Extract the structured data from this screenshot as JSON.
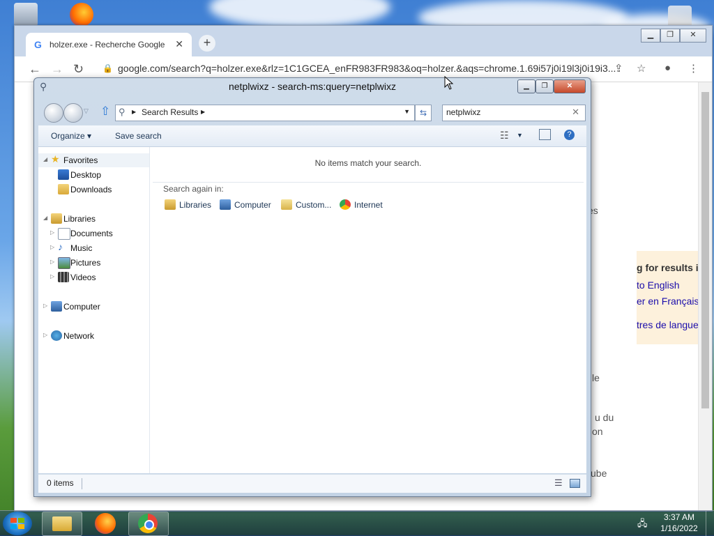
{
  "chrome": {
    "tab_title": "holzer.exe - Recherche Google",
    "tab_close": "✕",
    "new_tab": "+",
    "url": "google.com/search?q=holzer.exe&rlz=1C1GCEA_enFR983FR983&oq=holzer.&aqs=chrome.1.69i57j0i19l3j0i19i3...",
    "page_fragments": {
      "er": "er",
      "es": "es",
      "le": "le",
      "udu": "u du",
      "on": "on",
      "ube": "ube"
    },
    "language_box": {
      "title": "g for results in",
      "english": "to English",
      "french": "er en Français",
      "other": "tres de langue"
    }
  },
  "explorer": {
    "title": "netplwixz - search-ms:query=netplwixz",
    "address_crumb": "Search Results",
    "search_value": "netplwixz",
    "search_clear": "✕",
    "toolbar": {
      "organize": "Organize ▾",
      "save_search": "Save search",
      "help": "?"
    },
    "nav": {
      "favorites": "Favorites",
      "desktop": "Desktop",
      "downloads": "Downloads",
      "libraries": "Libraries",
      "documents": "Documents",
      "music": "Music",
      "pictures": "Pictures",
      "videos": "Videos",
      "computer": "Computer",
      "network": "Network"
    },
    "no_items": "No items match your search.",
    "search_again": "Search again in:",
    "search_again_items": [
      "Libraries",
      "Computer",
      "Custom...",
      "Internet"
    ],
    "status": "0 items"
  },
  "taskbar": {
    "time": "3:37 AM",
    "date": "1/16/2022"
  }
}
